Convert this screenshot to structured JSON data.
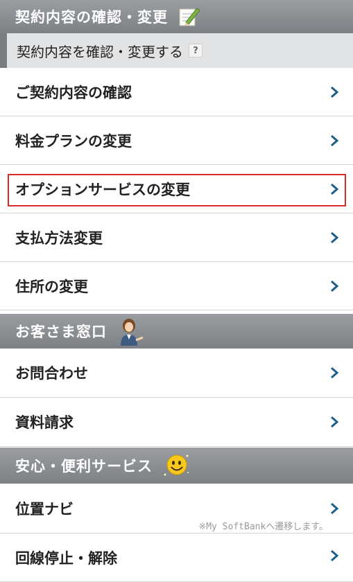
{
  "contract": {
    "header": "契約内容の確認・変更",
    "subheader": "契約内容を確認・変更する",
    "help_mark": "?",
    "items": [
      {
        "label": "ご契約内容の確認"
      },
      {
        "label": "料金プランの変更"
      },
      {
        "label": "オプションサービスの変更"
      },
      {
        "label": "支払方法変更"
      },
      {
        "label": "住所の変更"
      }
    ]
  },
  "support": {
    "header": "お客さま窓口",
    "items": [
      {
        "label": "お問合わせ"
      },
      {
        "label": "資料請求"
      }
    ]
  },
  "services": {
    "header": "安心・便利サービス",
    "items": [
      {
        "label": "位置ナビ"
      },
      {
        "label": "回線停止・解除"
      }
    ],
    "note": "※My SoftBankへ遷移します。"
  },
  "colors": {
    "header_bg": "#8b8e92",
    "chevron": "#1e5f8a",
    "highlight_border": "#d62b2b"
  }
}
